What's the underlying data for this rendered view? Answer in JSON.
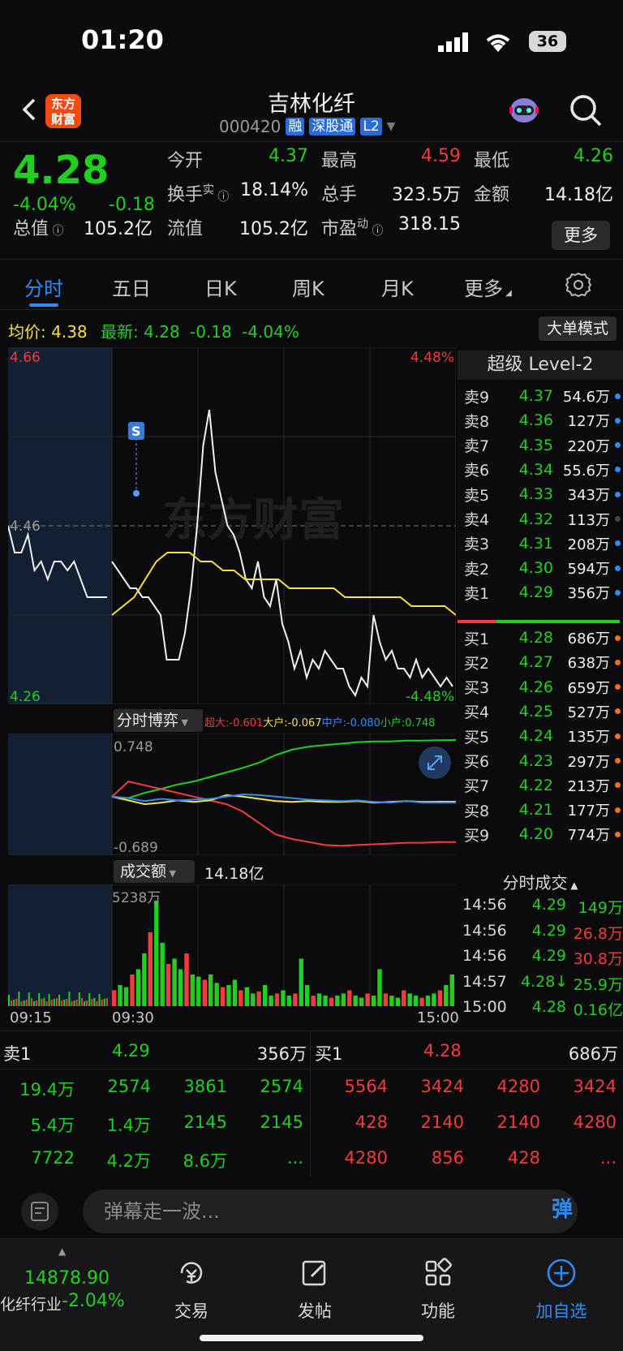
{
  "status": {
    "time": "01:20",
    "battery": "36"
  },
  "header": {
    "logo_line1": "东方",
    "logo_line2": "财富",
    "name": "吉林化纤",
    "code": "000420",
    "tags": [
      "融",
      "深股通",
      "L2"
    ]
  },
  "quote": {
    "price": "4.28",
    "chg_pct": "-4.04%",
    "chg_abs": "-0.18",
    "fields": [
      {
        "label": "今开",
        "value": "4.37",
        "color": "green"
      },
      {
        "label": "最高",
        "value": "4.59",
        "color": "red"
      },
      {
        "label": "最低",
        "value": "4.26",
        "color": "green"
      },
      {
        "label": "换手",
        "sup": "实",
        "value": "18.14%",
        "color": "white"
      },
      {
        "label": "总手",
        "value": "323.5万",
        "color": "white"
      },
      {
        "label": "金额",
        "value": "14.18亿",
        "color": "white"
      },
      {
        "label": "总值",
        "value": "105.2亿",
        "color": "white"
      },
      {
        "label": "流值",
        "value": "105.2亿",
        "color": "white"
      },
      {
        "label": "市盈",
        "sup": "动",
        "value": "318.15",
        "color": "white"
      }
    ],
    "more": "更多"
  },
  "tabs": [
    "分时",
    "五日",
    "日K",
    "周K",
    "月K",
    "更多"
  ],
  "avg": {
    "avg_label": "均价:",
    "avg_value": "4.38",
    "latest_label": "最新:",
    "latest_value": "4.28",
    "latest_chg": "-0.18",
    "latest_pct": "-4.04%",
    "bigorder": "大单模式"
  },
  "main_chart": {
    "y_top": "4.66",
    "y_mid": "4.46",
    "y_bot": "4.26",
    "pct_top": "4.48%",
    "pct_bot": "-4.48%",
    "marker": "S",
    "watermark": "东方财富",
    "ylim": [
      4.26,
      4.66
    ],
    "preclose": 4.46,
    "price_series": [
      4.42,
      4.41,
      4.4,
      4.39,
      4.39,
      4.38,
      4.38,
      4.37,
      4.36,
      4.31,
      4.31,
      4.31,
      4.34,
      4.39,
      4.46,
      4.55,
      4.59,
      4.52,
      4.49,
      4.46,
      4.45,
      4.43,
      4.4,
      4.39,
      4.42,
      4.38,
      4.37,
      4.4,
      4.35,
      4.33,
      4.3,
      4.32,
      4.29,
      4.31,
      4.3,
      4.32,
      4.31,
      4.3,
      4.3,
      4.28,
      4.27,
      4.29,
      4.28,
      4.36,
      4.33,
      4.31,
      4.32,
      4.3,
      4.3,
      4.29,
      4.31,
      4.29,
      4.3,
      4.29,
      4.28,
      4.29,
      4.28
    ],
    "avg_series": [
      4.36,
      4.37,
      4.38,
      4.4,
      4.42,
      4.43,
      4.43,
      4.43,
      4.42,
      4.42,
      4.41,
      4.41,
      4.4,
      4.4,
      4.4,
      4.4,
      4.39,
      4.39,
      4.39,
      4.39,
      4.39,
      4.38,
      4.38,
      4.38,
      4.38,
      4.38,
      4.38,
      4.37,
      4.37,
      4.37,
      4.37,
      4.36
    ],
    "premarket_series": [
      4.46,
      4.43,
      4.43,
      4.45,
      4.41,
      4.42,
      4.4,
      4.42,
      4.42,
      4.41,
      4.42,
      4.4,
      4.38,
      4.38,
      4.38,
      4.38
    ]
  },
  "bobo": {
    "title": "分时博弈",
    "legend": [
      {
        "label": "超大:-0.601",
        "color": "#f23c3c"
      },
      {
        "label": "大户:-0.067",
        "color": "#f5e23a"
      },
      {
        "label": "中户:-0.080",
        "color": "#2f8cf5"
      },
      {
        "label": "小户:0.748",
        "color": "#1fd11f"
      }
    ],
    "y_top": "0.748",
    "y_bot": "-0.689",
    "ylim": [
      -0.689,
      0.748
    ],
    "series": [
      {
        "color": "#1fd11f",
        "values": [
          0.0,
          -0.02,
          0.05,
          0.1,
          0.16,
          0.2,
          0.26,
          0.32,
          0.38,
          0.45,
          0.55,
          0.62,
          0.66,
          0.68,
          0.7,
          0.72,
          0.73,
          0.73,
          0.74,
          0.74,
          0.745,
          0.748
        ]
      },
      {
        "color": "#f23c3c",
        "values": [
          0.0,
          0.2,
          0.15,
          0.1,
          0.05,
          0.0,
          -0.05,
          -0.1,
          -0.2,
          -0.35,
          -0.5,
          -0.56,
          -0.6,
          -0.64,
          -0.65,
          -0.64,
          -0.63,
          -0.62,
          -0.61,
          -0.61,
          -0.6,
          -0.601
        ]
      },
      {
        "color": "#f5e23a",
        "values": [
          0.0,
          -0.05,
          -0.1,
          -0.08,
          -0.05,
          -0.07,
          -0.05,
          0.02,
          0.0,
          -0.03,
          -0.06,
          -0.07,
          -0.06,
          -0.07,
          -0.07,
          -0.06,
          -0.08,
          -0.07,
          -0.06,
          -0.07,
          -0.067,
          -0.067
        ]
      },
      {
        "color": "#2f8cf5",
        "values": [
          0.0,
          -0.02,
          -0.06,
          -0.03,
          -0.05,
          -0.04,
          -0.03,
          0.0,
          0.03,
          0.02,
          0.0,
          -0.02,
          -0.04,
          -0.05,
          -0.06,
          -0.05,
          -0.07,
          -0.08,
          -0.06,
          -0.08,
          -0.08,
          -0.08
        ]
      }
    ]
  },
  "volume": {
    "title": "成交额",
    "total": "14.18亿",
    "peak": "5238万",
    "x_start": "09:15",
    "x_open": "09:30",
    "x_end": "15:00",
    "bars": [
      0.15,
      0.2,
      0.18,
      0.3,
      0.35,
      0.5,
      0.7,
      1.0,
      0.6,
      0.4,
      0.45,
      0.35,
      0.5,
      0.3,
      0.28,
      0.25,
      0.3,
      0.22,
      0.18,
      0.2,
      0.25,
      0.15,
      0.18,
      0.12,
      0.14,
      0.2,
      0.1,
      0.12,
      0.15,
      0.1,
      0.12,
      0.45,
      0.2,
      0.1,
      0.12,
      0.1,
      0.08,
      0.1,
      0.12,
      0.15,
      0.1,
      0.08,
      0.12,
      0.1,
      0.35,
      0.12,
      0.1,
      0.08,
      0.15,
      0.12,
      0.1,
      0.08,
      0.1,
      0.12,
      0.15,
      0.2,
      0.3
    ]
  },
  "level2": {
    "title": "超级 Level-2",
    "asks": [
      {
        "label": "卖9",
        "price": "4.37",
        "vol": "54.6万",
        "dot": "#2f8cf5"
      },
      {
        "label": "卖8",
        "price": "4.36",
        "vol": "127万",
        "dot": "#2f8cf5"
      },
      {
        "label": "卖7",
        "price": "4.35",
        "vol": "220万",
        "dot": "#2f8cf5"
      },
      {
        "label": "卖6",
        "price": "4.34",
        "vol": "55.6万",
        "dot": "#2f8cf5"
      },
      {
        "label": "卖5",
        "price": "4.33",
        "vol": "343万",
        "dot": "#2f8cf5"
      },
      {
        "label": "卖4",
        "price": "4.32",
        "vol": "113万",
        "dot": "#444444"
      },
      {
        "label": "卖3",
        "price": "4.31",
        "vol": "208万",
        "dot": "#2f8cf5"
      },
      {
        "label": "卖2",
        "price": "4.30",
        "vol": "594万",
        "dot": "#2f8cf5"
      },
      {
        "label": "卖1",
        "price": "4.29",
        "vol": "356万",
        "dot": "#2f8cf5"
      }
    ],
    "bids": [
      {
        "label": "买1",
        "price": "4.28",
        "vol": "686万",
        "dot": "#f2701c"
      },
      {
        "label": "买2",
        "price": "4.27",
        "vol": "638万",
        "dot": "#f2701c"
      },
      {
        "label": "买3",
        "price": "4.26",
        "vol": "659万",
        "dot": "#f2701c"
      },
      {
        "label": "买4",
        "price": "4.25",
        "vol": "527万",
        "dot": "#f2701c"
      },
      {
        "label": "买5",
        "price": "4.24",
        "vol": "135万",
        "dot": "#f2701c"
      },
      {
        "label": "买6",
        "price": "4.23",
        "vol": "297万",
        "dot": "#f2701c"
      },
      {
        "label": "买7",
        "price": "4.22",
        "vol": "213万",
        "dot": "#f2701c"
      },
      {
        "label": "买8",
        "price": "4.21",
        "vol": "177万",
        "dot": "#f2701c"
      },
      {
        "label": "买9",
        "price": "4.20",
        "vol": "774万",
        "dot": "#f2701c"
      }
    ],
    "trades_title": "分时成交",
    "trades": [
      {
        "time": "14:56",
        "price": "4.29",
        "vol": "149万",
        "vcolor": "green"
      },
      {
        "time": "14:56",
        "price": "4.29",
        "vol": "26.8万",
        "vcolor": "red"
      },
      {
        "time": "14:56",
        "price": "4.29",
        "vol": "30.8万",
        "vcolor": "red"
      },
      {
        "time": "14:57",
        "price": "4.28↓",
        "vol": "25.9万",
        "vcolor": "green"
      },
      {
        "time": "15:00",
        "price": "4.28",
        "vol": "0.16亿",
        "vcolor": "green"
      }
    ]
  },
  "book": {
    "sell_label": "卖1",
    "sell_price": "4.29",
    "sell_vol": "356万",
    "buy_label": "买1",
    "buy_price": "4.28",
    "buy_vol": "686万",
    "sell_rows": [
      [
        "19.4万",
        "2574",
        "3861",
        "2574"
      ],
      [
        "5.4万",
        "1.4万",
        "2145",
        "2145"
      ],
      [
        "7722",
        "4.2万",
        "8.6万",
        "..."
      ]
    ],
    "buy_rows": [
      [
        "5564",
        "3424",
        "4280",
        "3424"
      ],
      [
        "428",
        "2140",
        "2140",
        "4280"
      ],
      [
        "4280",
        "856",
        "428",
        "..."
      ]
    ]
  },
  "input": {
    "placeholder": "弹幕走一波...",
    "btn": "弹"
  },
  "nav": {
    "index_value": "14878.90",
    "index_name": "化纤行业",
    "index_chg": "-2.04%",
    "items": [
      {
        "label": "交易"
      },
      {
        "label": "发帖"
      },
      {
        "label": "功能"
      },
      {
        "label": "加自选"
      }
    ]
  }
}
